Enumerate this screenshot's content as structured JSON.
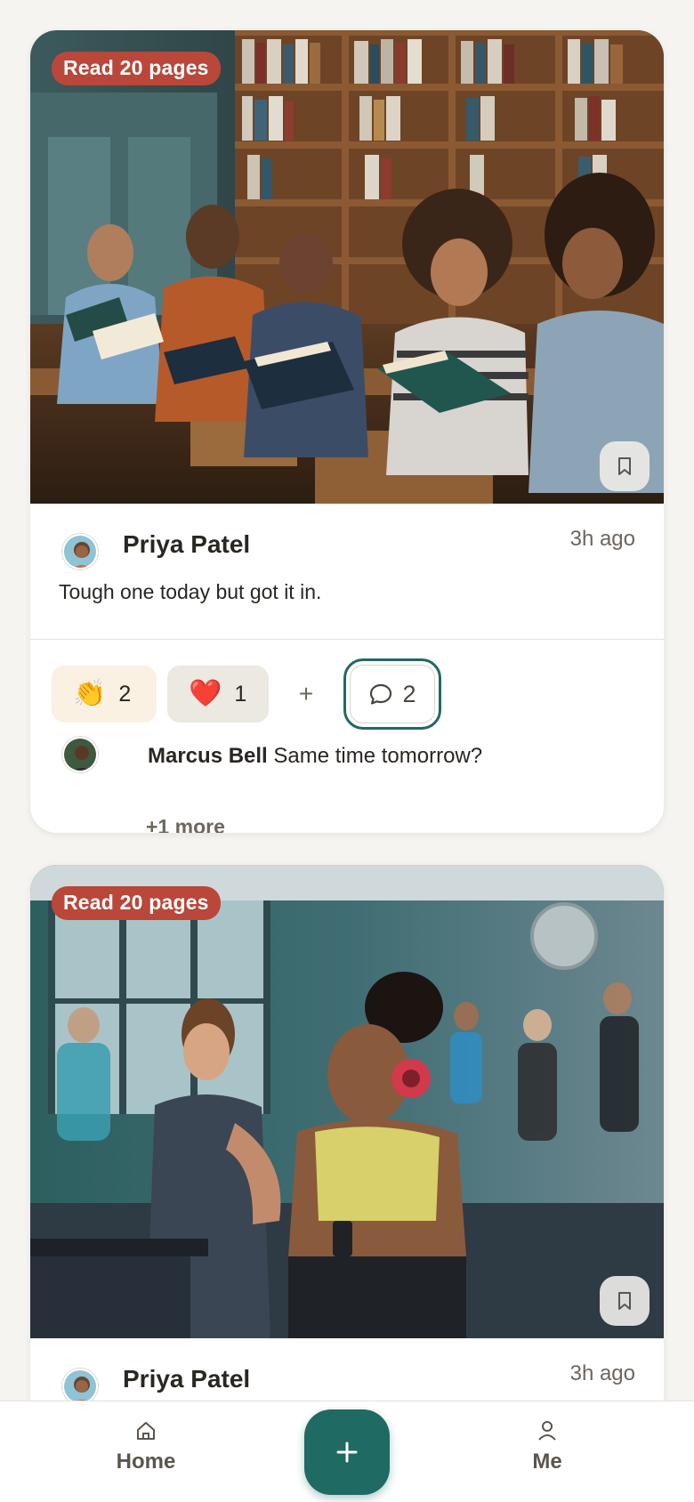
{
  "feed": {
    "posts": [
      {
        "goal": "Read 20 pages",
        "author": "Priya Patel",
        "time": "3h ago",
        "caption": "Tough one today but got it in.",
        "reactions": [
          {
            "emoji": "👏",
            "count": "2"
          },
          {
            "emoji": "❤️",
            "count": "1"
          }
        ],
        "add_reaction": "+",
        "comment_count": "2",
        "comment": {
          "author": "Marcus Bell",
          "text": "Same time tomorrow?"
        },
        "more_comments": "+1 more",
        "photo_icon": "library-reading-photo"
      },
      {
        "goal": "Read 20 pages",
        "author": "Priya Patel",
        "time": "3h ago",
        "photo_icon": "gym-running-photo"
      }
    ]
  },
  "tabbar": {
    "home_label": "Home",
    "me_label": "Me",
    "create_label": "+"
  },
  "colors": {
    "accent": "#1f6a63",
    "badge": "#b9473a",
    "background": "#f6f4f1"
  }
}
